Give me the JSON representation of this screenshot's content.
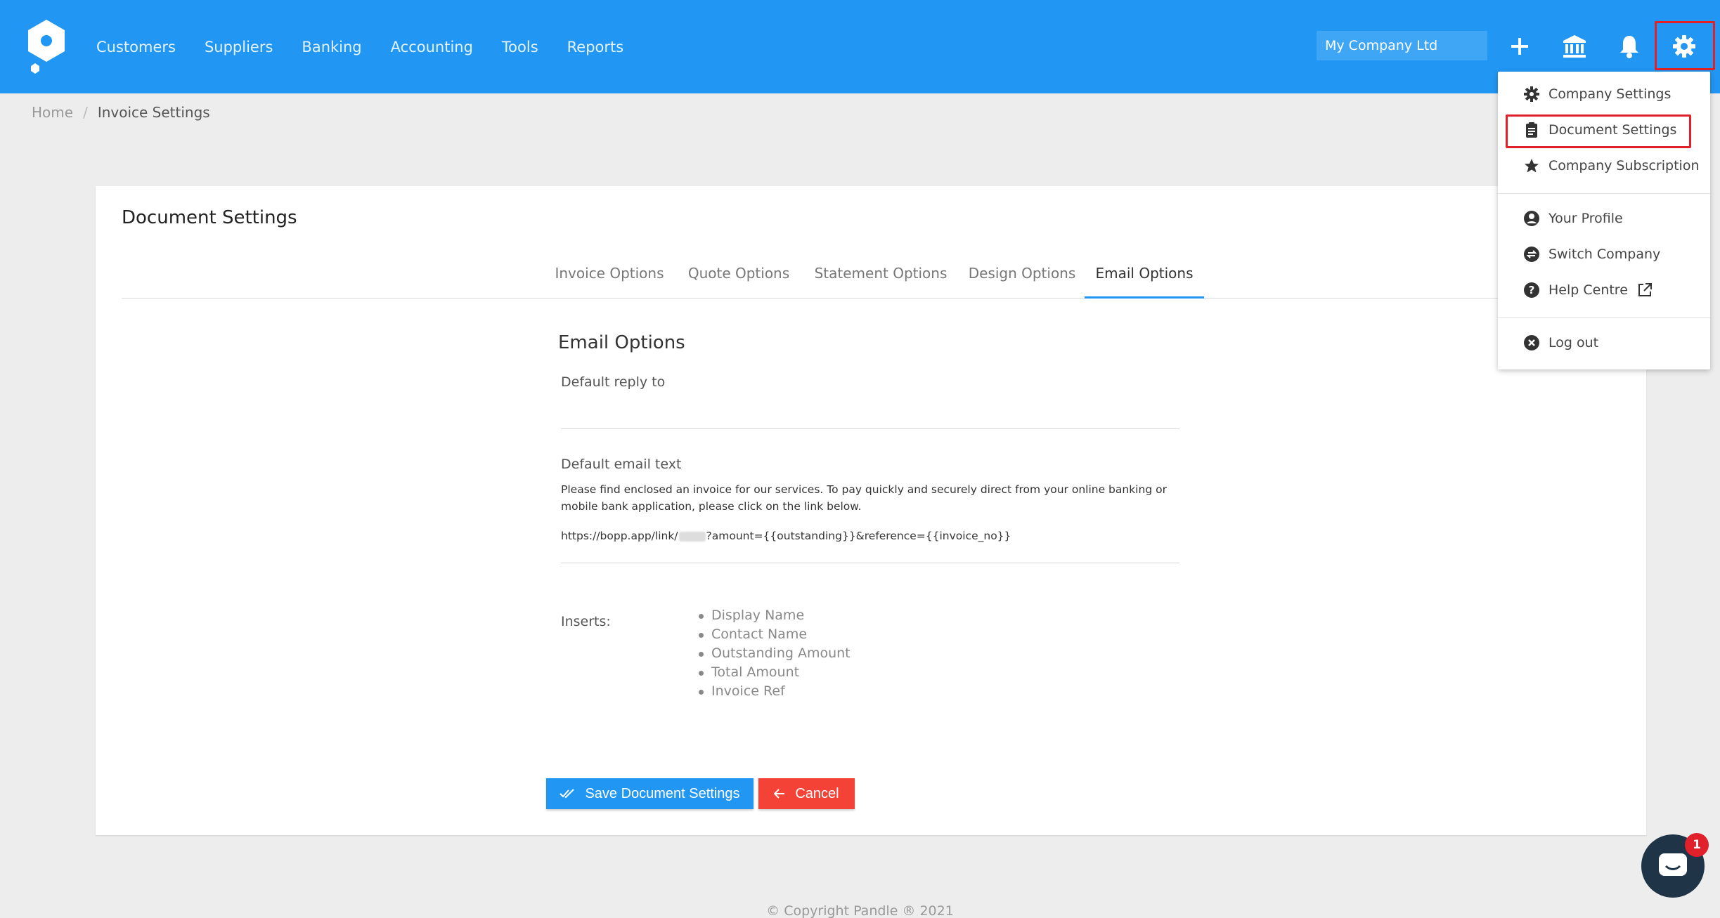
{
  "nav": {
    "items": [
      "Customers",
      "Suppliers",
      "Banking",
      "Accounting",
      "Tools",
      "Reports"
    ],
    "company": "My Company Ltd"
  },
  "breadcrumb": {
    "home": "Home",
    "separator": "/",
    "current": "Invoice Settings"
  },
  "card": {
    "title": "Document Settings",
    "tabs": [
      "Invoice Options",
      "Quote Options",
      "Statement Options",
      "Design Options",
      "Email Options"
    ],
    "active_tab": "Email Options",
    "section_title": "Email Options",
    "reply_label": "Default reply to",
    "reply_value": "",
    "email_text_label": "Default email text",
    "email_text": "Please find enclosed an invoice for our services.  To pay quickly and securely direct from your online banking or mobile bank application, please click on the link below.",
    "email_link_prefix": "https://bopp.app/link/",
    "email_link_suffix": "?amount={{outstanding}}&reference={{invoice_no}}",
    "inserts_label": "Inserts:",
    "inserts": [
      "Display Name",
      "Contact Name",
      "Outstanding Amount",
      "Total Amount",
      "Invoice Ref"
    ],
    "save_label": "Save Document Settings",
    "cancel_label": "Cancel"
  },
  "dropdown": {
    "company_settings": "Company Settings",
    "document_settings": "Document Settings",
    "company_subscription": "Company Subscription",
    "your_profile": "Your Profile",
    "switch_company": "Switch Company",
    "help_centre": "Help Centre",
    "log_out": "Log out"
  },
  "footer": "© Copyright Pandle ® 2021",
  "chat": {
    "badge": "1"
  },
  "colors": {
    "primary": "#2196f3",
    "danger": "#f44336",
    "highlight": "#e0202a"
  },
  "icons": [
    "logo-icon",
    "plus-icon",
    "bank-icon",
    "bell-icon",
    "gear-icon",
    "clipboard-icon",
    "star-icon",
    "account-circle-icon",
    "switch-icon",
    "help-icon",
    "external-link-icon",
    "close-circle-icon",
    "check-icon",
    "arrow-left-icon",
    "chat-icon"
  ]
}
